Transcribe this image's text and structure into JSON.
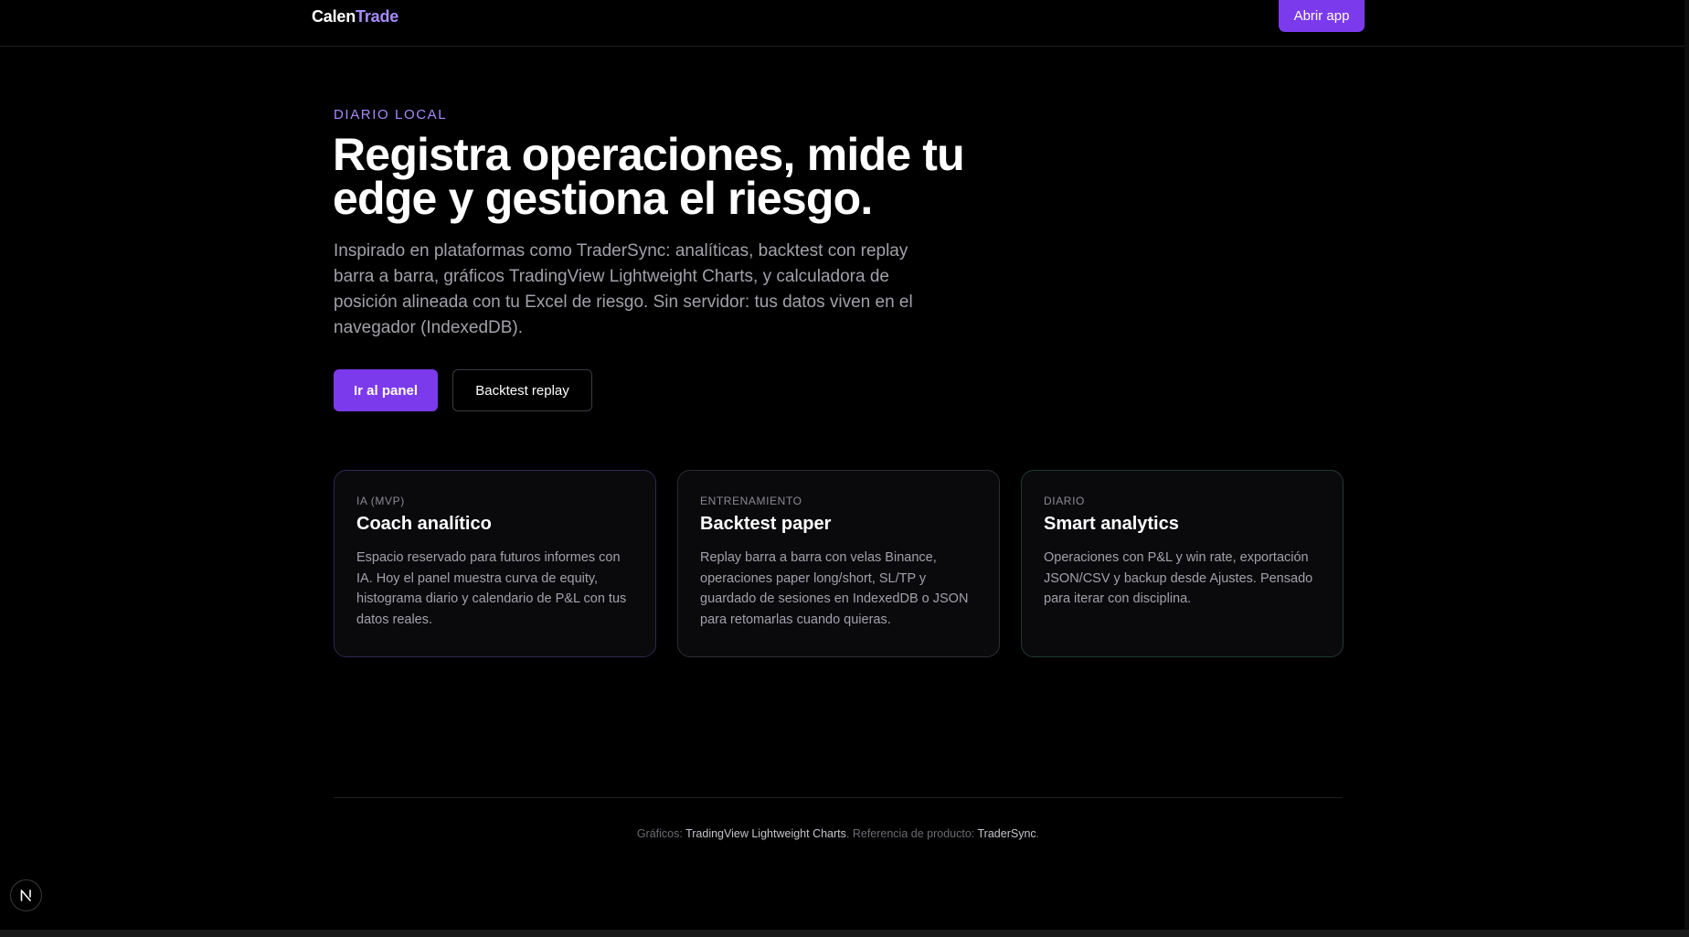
{
  "header": {
    "logo_part1": "Calen",
    "logo_part2": "Trade",
    "open_app_label": "Abrir app"
  },
  "hero": {
    "eyebrow": "DIARIO LOCAL",
    "title": "Registra operaciones, mide tu edge y gestiona el riesgo.",
    "lead": "Inspirado en plataformas como TraderSync: analíticas, backtest con replay barra a barra, gráficos TradingView Lightweight Charts, y calculadora de posición alineada con tu Excel de riesgo. Sin servidor: tus datos viven en el navegador (IndexedDB).",
    "primary_label": "Ir al panel",
    "secondary_label": "Backtest replay"
  },
  "cards": [
    {
      "tag": "IA (MVP)",
      "title": "Coach analítico",
      "desc": "Espacio reservado para futuros informes con IA. Hoy el panel muestra curva de equity, histograma diario y calendario de P&L con tus datos reales."
    },
    {
      "tag": "ENTRENAMIENTO",
      "title": "Backtest paper",
      "desc": "Replay barra a barra con velas Binance, operaciones paper long/short, SL/TP y guardado de sesiones en IndexedDB o JSON para retomarlas cuando quieras."
    },
    {
      "tag": "DIARIO",
      "title": "Smart analytics",
      "desc": "Operaciones con P&L y win rate, exportación JSON/CSV y backup desde Ajustes. Pensado para iterar con disciplina."
    }
  ],
  "footer": {
    "charts_prefix": "Gráficos: ",
    "charts_link": "TradingView Lightweight Charts",
    "product_prefix": ". Referencia de producto: ",
    "product_link": "TraderSync",
    "suffix": "."
  },
  "badge": {
    "letter": "N",
    "icon": "nextjs-icon"
  },
  "colors": {
    "accent": "#7c3aed",
    "accent_light": "#a78bfa",
    "background": "#000000"
  }
}
